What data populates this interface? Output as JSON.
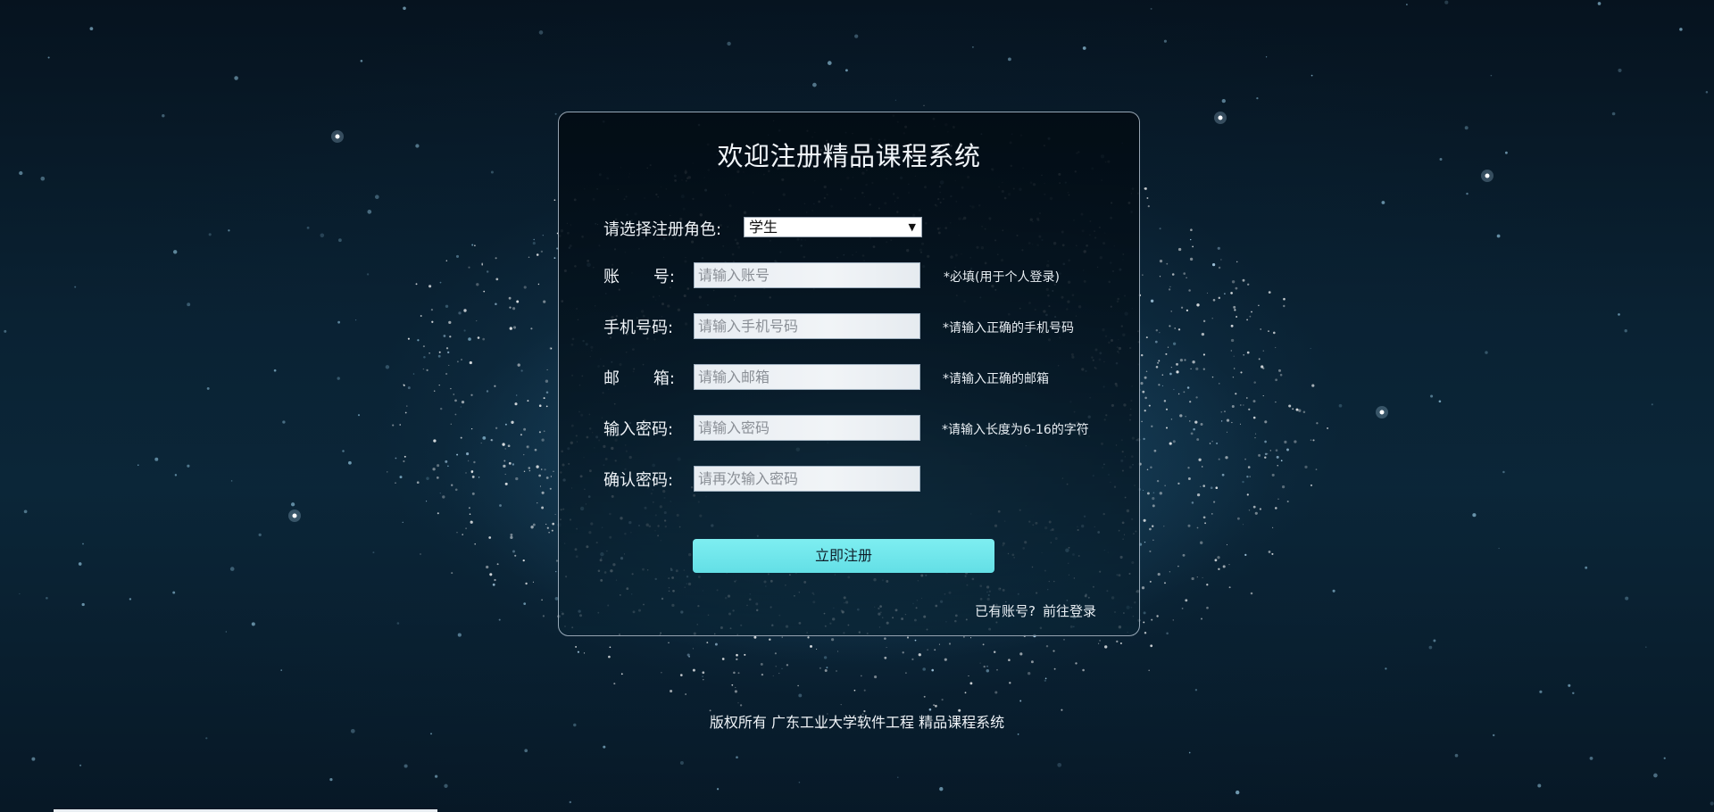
{
  "form": {
    "title": "欢迎注册精品课程系统",
    "role_label": "请选择注册角色:",
    "role_selected": "学生",
    "fields": [
      {
        "label_chars": [
          "账",
          "号:"
        ],
        "placeholder": "请输入账号",
        "hint": "*必填(用于个人登录)"
      },
      {
        "label": "手机号码:",
        "placeholder": "请输入手机号码",
        "hint": "*请输入正确的手机号码"
      },
      {
        "label_chars": [
          "邮",
          "箱:"
        ],
        "placeholder": "请输入邮箱",
        "hint": "*请输入正确的邮箱"
      },
      {
        "label": "输入密码:",
        "placeholder": "请输入密码",
        "hint": "*请输入长度为6-16的字符"
      },
      {
        "label": "确认密码:",
        "placeholder": "请再次输入密码",
        "hint": ""
      }
    ],
    "submit_label": "立即注册",
    "has_account_text": "已有账号?",
    "login_link": "前往登录"
  },
  "footer": {
    "text": "版权所有 广东工业大学软件工程 精品课程系统"
  },
  "colors": {
    "button": "#6ae5eb",
    "card_border": "#c8d7e6",
    "background": "#0a2233"
  }
}
